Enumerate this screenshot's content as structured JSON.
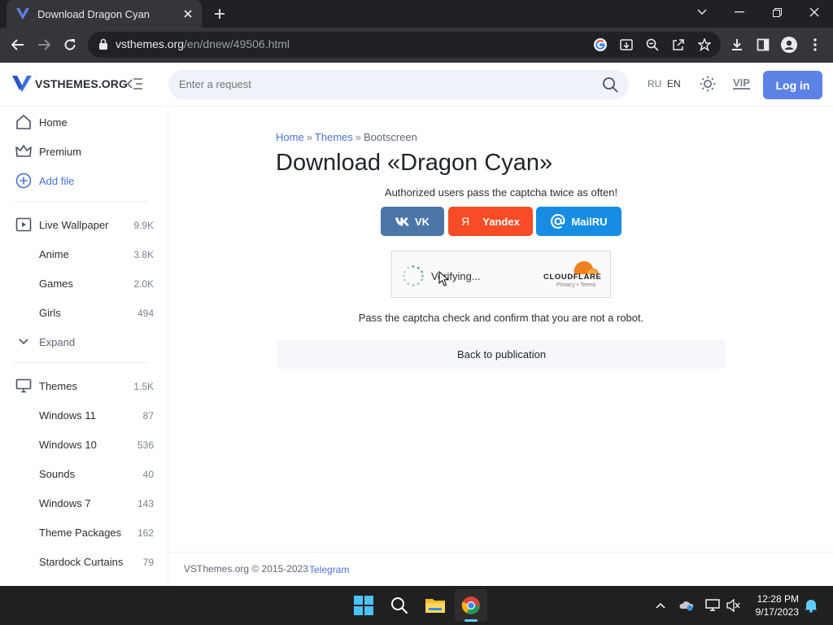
{
  "browser": {
    "tab_title": "Download Dragon Cyan",
    "url_host": "vsthemes.org",
    "url_path": "/en/dnew/49506.html"
  },
  "header": {
    "logo_text": "VSTHEMES.ORG",
    "search_placeholder": "Enter a request",
    "lang_ru": "RU",
    "lang_en": "EN",
    "vip_label": "VIP",
    "login_label": "Log in"
  },
  "sidebar": {
    "primary": [
      {
        "label": "Home",
        "icon": "home-icon"
      },
      {
        "label": "Premium",
        "icon": "crown-icon"
      },
      {
        "label": "Add file",
        "icon": "add-circle-icon"
      }
    ],
    "wallpaper": [
      {
        "label": "Live Wallpaper",
        "count": "9.9K"
      },
      {
        "label": "Anime",
        "count": "3.8K"
      },
      {
        "label": "Games",
        "count": "2.0K"
      },
      {
        "label": "Girls",
        "count": "494"
      }
    ],
    "expand_label": "Expand",
    "themes": [
      {
        "label": "Themes",
        "count": "1.5K"
      },
      {
        "label": "Windows 11",
        "count": "87"
      },
      {
        "label": "Windows 10",
        "count": "536"
      },
      {
        "label": "Sounds",
        "count": "40"
      },
      {
        "label": "Windows 7",
        "count": "143"
      },
      {
        "label": "Theme Packages",
        "count": "162"
      },
      {
        "label": "Stardock Curtains",
        "count": "79"
      }
    ]
  },
  "main": {
    "breadcrumb": [
      "Home",
      "Themes",
      "Bootscreen"
    ],
    "breadcrumb_sep": "»",
    "title": "Download «Dragon Cyan»",
    "auth_note": "Authorized users pass the captcha twice as often!",
    "social": {
      "vk": "VK",
      "yandex": "Yandex",
      "mailru": "MailRU"
    },
    "captcha": {
      "status": "Verifying...",
      "brand": "CLOUDFLARE",
      "links": "Privacy • Terms"
    },
    "pass_note": "Pass the captcha check and confirm that you are not a robot.",
    "back_label": "Back to publication"
  },
  "footer": {
    "copyright": "VSThemes.org © 2015-2023",
    "telegram": "Telegram"
  },
  "taskbar": {
    "time": "12:28 PM",
    "date": "9/17/2023"
  },
  "colors": {
    "accent": "#5b82e6",
    "link": "#4a72d8",
    "vk": "#4c76a8",
    "yandex": "#f74c25",
    "mailru": "#168de2",
    "chrome_dark": "#202124"
  }
}
